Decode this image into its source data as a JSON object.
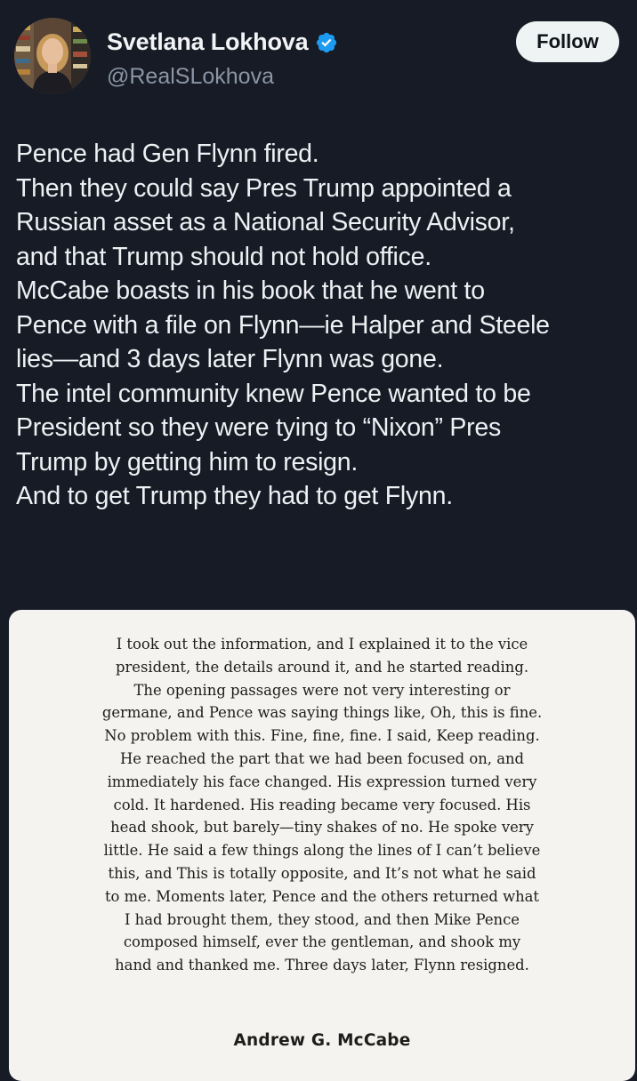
{
  "tweet": {
    "author": {
      "display_name": "Svetlana Lokhova",
      "handle": "@RealSLokhova",
      "verified": true,
      "verified_color": "#1d9bf0"
    },
    "follow_label": "Follow",
    "lines": [
      "Pence had Gen Flynn fired.",
      "Then they could say Pres Trump appointed a",
      "Russian asset as a National Security Advisor,",
      "and that Trump should not hold office.",
      "McCabe boasts in his book  that he went to",
      "Pence with a file on Flynn—ie Halper and Steele",
      "lies—and 3 days later Flynn was gone.",
      "The intel community knew Pence wanted to be",
      "President so they were tying to “Nixon” Pres",
      "Trump by getting him to resign.",
      "And to get Trump they had to get Flynn."
    ]
  },
  "excerpt": {
    "lines": [
      "I took out the information, and I explained it to the vice",
      "president, the details around it, and he started reading.",
      "The opening passages were not very interesting or",
      "germane, and Pence was saying things like, Oh, this is fine.",
      "No problem with this. Fine, fine, fine. I said, Keep reading.",
      "He reached the part that we had been focused on, and",
      "immediately his face changed. His expression turned very",
      "cold. It hardened. His reading became very focused. His",
      "head shook, but barely—tiny shakes of no. He spoke very",
      "little. He said a few things along the lines of I can’t believe",
      "this, and This is totally opposite, and It’s not what he said",
      "to me. Moments later, Pence and the others returned what",
      "I had brought them, they stood, and then Mike Pence",
      "composed himself, ever the gentleman, and shook my",
      "hand and thanked me. Three days later, Flynn resigned."
    ],
    "author": "Andrew G. McCabe"
  },
  "colors": {
    "background": "#161b26",
    "text_primary": "#eef0f3",
    "text_secondary": "#8b96a4",
    "card_background": "#f5f3ef"
  },
  "icons": {
    "verified": "verified-badge-icon",
    "avatar": "profile-photo"
  }
}
